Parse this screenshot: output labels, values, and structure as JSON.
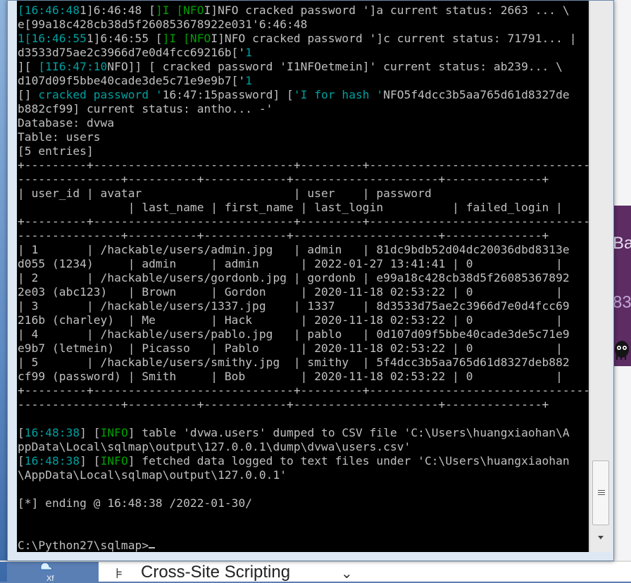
{
  "background": {
    "right_tab_text_1": "Ba",
    "right_tab_text_2": "83",
    "bottom_tab_label": "Cross-Site Scripting",
    "desktop_label": "Xf"
  },
  "console": {
    "lines": [
      [
        [
          "t",
          "["
        ],
        [
          "t",
          "16:46:48"
        ],
        [
          "c",
          "1]6:46:48 ["
        ],
        [
          "g",
          "]I [NFO"
        ],
        [
          "c",
          "I]NFO cracked password ']a current status: 2663 ... \\"
        ]
      ],
      [
        [
          "c",
          "e[99a18c428cb38d5f260853678922e031'6:46:48"
        ]
      ],
      [
        [
          "t",
          "1[16:46:55"
        ],
        [
          "c",
          "1]6:46:55 ["
        ],
        [
          "g",
          "]I [NFO"
        ],
        [
          "c",
          "I]NFO cracked password ']c current status: 71791... |"
        ]
      ],
      [
        [
          "c",
          "d3533d75ae2c3966d7e0d4fcc69216b['"
        ],
        [
          "t",
          "1"
        ]
      ],
      [
        [
          "c",
          "][ "
        ],
        [
          "t",
          "[1I6:47:10"
        ],
        [
          "c",
          "NFO]] [ cracked password 'I1NFOetmein]' current status: ab239... \\"
        ]
      ],
      [
        [
          "c",
          "d107d09f5bbe40cade3de5c71e9e9b7['"
        ],
        [
          "t",
          "1"
        ]
      ],
      [
        [
          "c",
          "[] "
        ],
        [
          "t",
          "cracked password '"
        ],
        [
          "c",
          "16:47:15password] ["
        ],
        [
          "t",
          "'I for hash '"
        ],
        [
          "c",
          "NFO5f4dcc3b5aa765d61d8327de"
        ]
      ],
      [
        [
          "c",
          "b882cf99] current status: antho... -'"
        ]
      ],
      [
        [
          "c",
          "Database: dvwa"
        ]
      ],
      [
        [
          "c",
          "Table: users"
        ]
      ],
      [
        [
          "c",
          "[5 entries]"
        ]
      ],
      [
        [
          "c",
          "+---------+-----------------------------+---------+---------------------------------"
        ]
      ],
      [
        [
          "c",
          "---------------+----------+------------+---------------------+--------------+"
        ]
      ],
      [
        [
          "c",
          "| user_id | avatar                      | user    | password"
        ]
      ],
      [
        [
          "c",
          "                | last_name | first_name | last_login          | failed_login |"
        ]
      ],
      [
        [
          "c",
          "+---------+-----------------------------+---------+---------------------------------"
        ]
      ],
      [
        [
          "c",
          "---------------+----------+------------+---------------------+--------------+"
        ]
      ],
      [
        [
          "c",
          "| 1       | /hackable/users/admin.jpg   | admin   | 81dc9bdb52d04dc20036dbd8313e"
        ]
      ],
      [
        [
          "c",
          "d055 (1234)     | admin     | admin      | 2022-01-27 13:41:41 | 0            |"
        ]
      ],
      [
        [
          "c",
          "| 2       | /hackable/users/gordonb.jpg | gordonb | e99a18c428cb38d5f26085367892"
        ]
      ],
      [
        [
          "c",
          "2e03 (abc123)   | Brown     | Gordon     | 2020-11-18 02:53:22 | 0            |"
        ]
      ],
      [
        [
          "c",
          "| 3       | /hackable/users/1337.jpg    | 1337    | 8d3533d75ae2c3966d7e0d4fcc69"
        ]
      ],
      [
        [
          "c",
          "216b (charley)  | Me        | Hack       | 2020-11-18 02:53:22 | 0            |"
        ]
      ],
      [
        [
          "c",
          "| 4       | /hackable/users/pablo.jpg   | pablo   | 0d107d09f5bbe40cade3de5c71e9"
        ]
      ],
      [
        [
          "c",
          "e9b7 (letmein)  | Picasso   | Pablo      | 2020-11-18 02:53:22 | 0            |"
        ]
      ],
      [
        [
          "c",
          "| 5       | /hackable/users/smithy.jpg  | smithy  | 5f4dcc3b5aa765d61d8327deb882"
        ]
      ],
      [
        [
          "c",
          "cf99 (password) | Smith     | Bob        | 2020-11-18 02:53:22 | 0            |"
        ]
      ],
      [
        [
          "c",
          "+---------+-----------------------------+---------+---------------------------------"
        ]
      ],
      [
        [
          "c",
          "---------------+----------+------------+---------------------+--------------+"
        ]
      ],
      [
        [
          "c",
          ""
        ]
      ],
      [
        [
          "c",
          "["
        ],
        [
          "t",
          "16:48:38"
        ],
        [
          "c",
          "] ["
        ],
        [
          "g",
          "INFO"
        ],
        [
          "c",
          "] table 'dvwa.users' dumped to CSV file 'C:\\Users\\huangxiaohan\\A"
        ]
      ],
      [
        [
          "c",
          "ppData\\Local\\sqlmap\\output\\127.0.0.1\\dump\\dvwa\\users.csv'"
        ]
      ],
      [
        [
          "c",
          "["
        ],
        [
          "t",
          "16:48:38"
        ],
        [
          "c",
          "] ["
        ],
        [
          "g",
          "INFO"
        ],
        [
          "c",
          "] fetched data logged to text files under 'C:\\Users\\huangxiaohan"
        ]
      ],
      [
        [
          "c",
          "\\AppData\\Local\\sqlmap\\output\\127.0.0.1'"
        ]
      ],
      [
        [
          "c",
          ""
        ]
      ],
      [
        [
          "c",
          "[*] ending @ 16:48:38 /2022-01-30/"
        ]
      ],
      [
        [
          "c",
          ""
        ]
      ],
      [
        [
          "c",
          ""
        ]
      ],
      [
        [
          "c",
          "C:\\Python27\\sqlmap>"
        ]
      ]
    ]
  },
  "colors": {
    "timestamp": "#00a0a0",
    "info": "#00a000",
    "text": "#c0c0c0",
    "console_bg": "#000000"
  },
  "icons": {
    "scroll_down": "chevron-down-icon",
    "scroll_grip": "grip-icon"
  }
}
